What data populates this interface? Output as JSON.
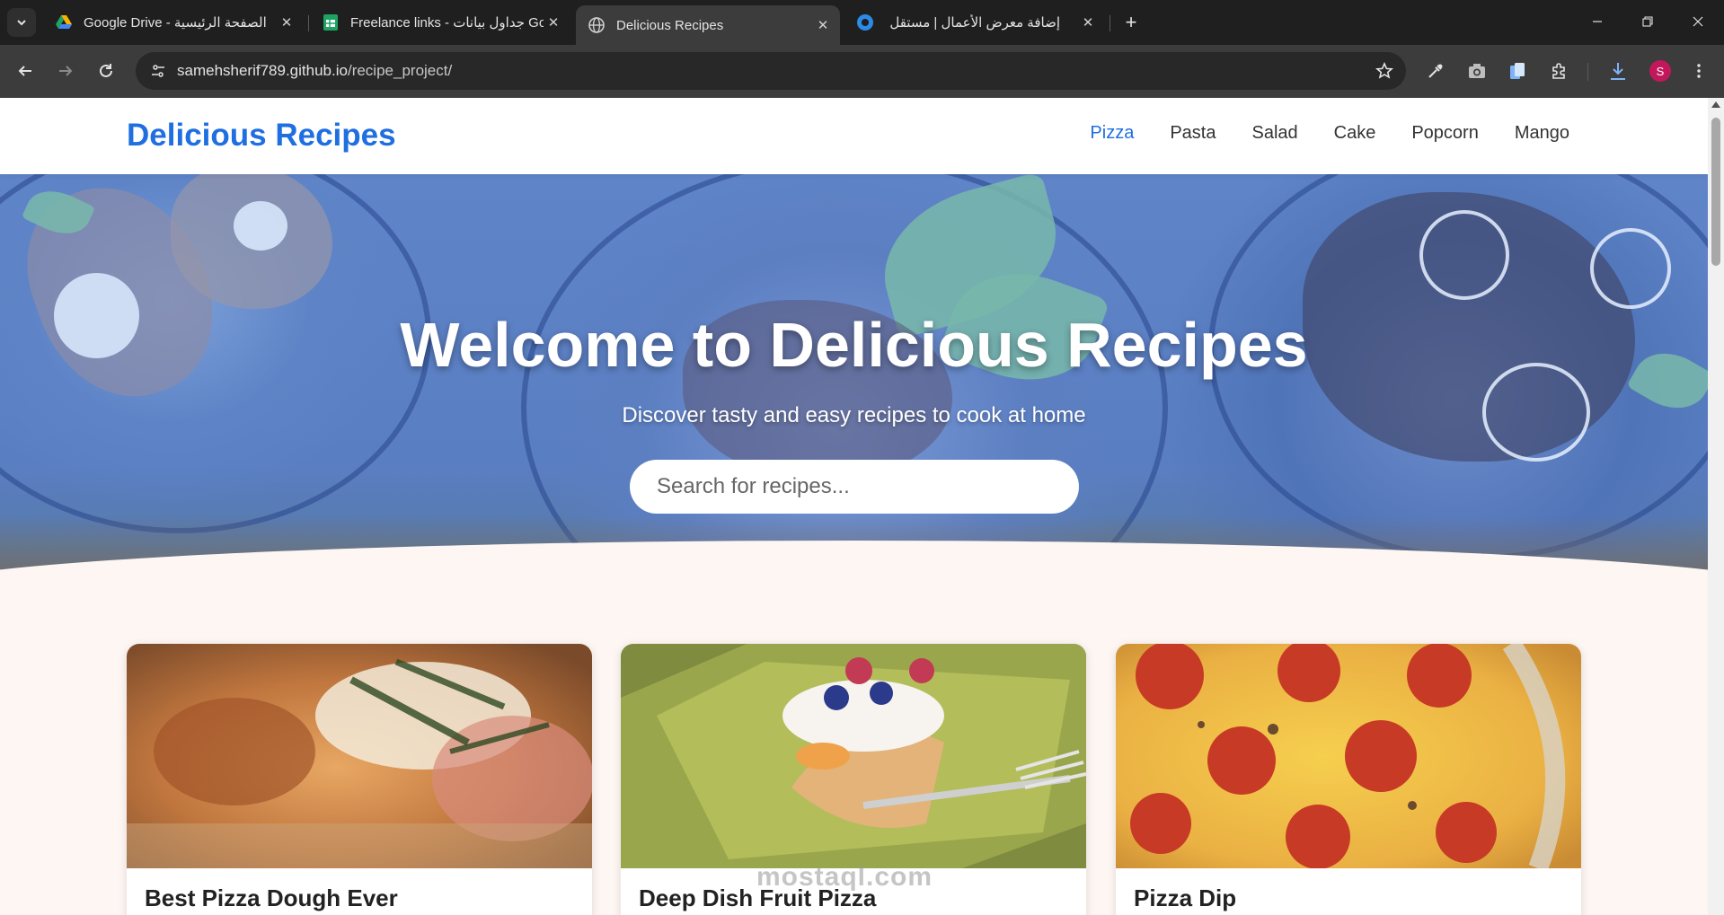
{
  "browser": {
    "tabs": [
      {
        "title": "Google Drive - الصفحة الرئيسية",
        "icon": "google-drive-icon",
        "active": false
      },
      {
        "title": "Freelance links - جداول بيانات Go",
        "icon": "google-sheets-icon",
        "active": false
      },
      {
        "title": "Delicious Recipes",
        "icon": "globe-icon",
        "active": true
      },
      {
        "title": "إضافة معرض الأعمال | مستقل",
        "icon": "mostaql-icon",
        "active": false
      }
    ],
    "new_tab": "+",
    "url_host": "samehsherif789.github.io",
    "url_path": "/recipe_project/",
    "profile_initial": "S"
  },
  "site": {
    "brand": "Delicious Recipes",
    "nav": [
      "Pizza",
      "Pasta",
      "Salad",
      "Cake",
      "Popcorn",
      "Mango"
    ],
    "active_nav": "Pizza",
    "hero": {
      "title": "Welcome to Delicious Recipes",
      "subtitle": "Discover tasty and easy recipes to cook at home",
      "search_placeholder": "Search for recipes..."
    },
    "recipes": [
      {
        "title": "Best Pizza Dough Ever"
      },
      {
        "title": "Deep Dish Fruit Pizza"
      },
      {
        "title": "Pizza Dip"
      }
    ]
  },
  "watermark": "mostaql.com",
  "colors": {
    "accent": "#1f6fe0",
    "page_bg": "#fdf6f2",
    "hero_overlay": "#5a7ec2"
  }
}
